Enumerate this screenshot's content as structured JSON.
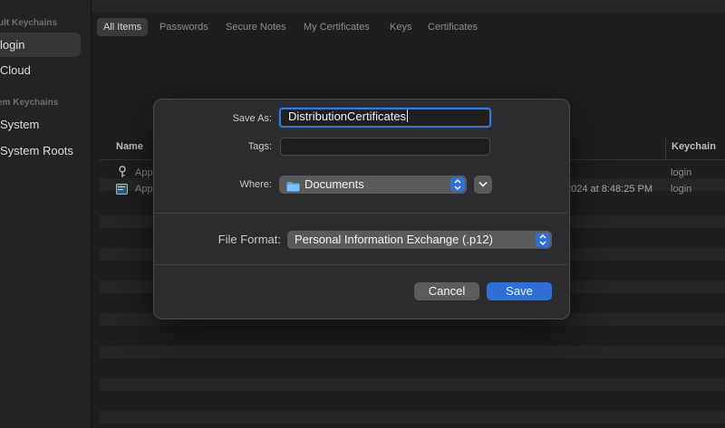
{
  "sidebar": {
    "default_heading": "ult Keychains",
    "login": "login",
    "icloud": "iCloud",
    "system_heading": "em Keychains",
    "system": "System",
    "system_roots": "System Roots"
  },
  "tabs": [
    "All Items",
    "Passwords",
    "Secure Notes",
    "My Certificates",
    "Keys",
    "Certificates"
  ],
  "table": {
    "col_name": "Name",
    "col_keychain": "Keychain",
    "rows": [
      {
        "name": "App",
        "icon": "key-icon",
        "date": "",
        "keychain": "login"
      },
      {
        "name": "App",
        "icon": "certificate-icon",
        "date": "2024 at 8:48:25 PM",
        "keychain": "login"
      }
    ]
  },
  "dialog": {
    "save_as_label": "Save As:",
    "save_as_value": "DistributionCertificates",
    "tags_label": "Tags:",
    "tags_value": "",
    "where_label": "Where:",
    "where_value": "Documents",
    "file_format_label": "File Format:",
    "file_format_value": "Personal Information Exchange (.p12)",
    "cancel_label": "Cancel",
    "save_label": "Save"
  },
  "colors": {
    "accent": "#2f6fd8",
    "dialog_bg": "#2c2c2e",
    "window_bg": "#1e1e1e"
  }
}
